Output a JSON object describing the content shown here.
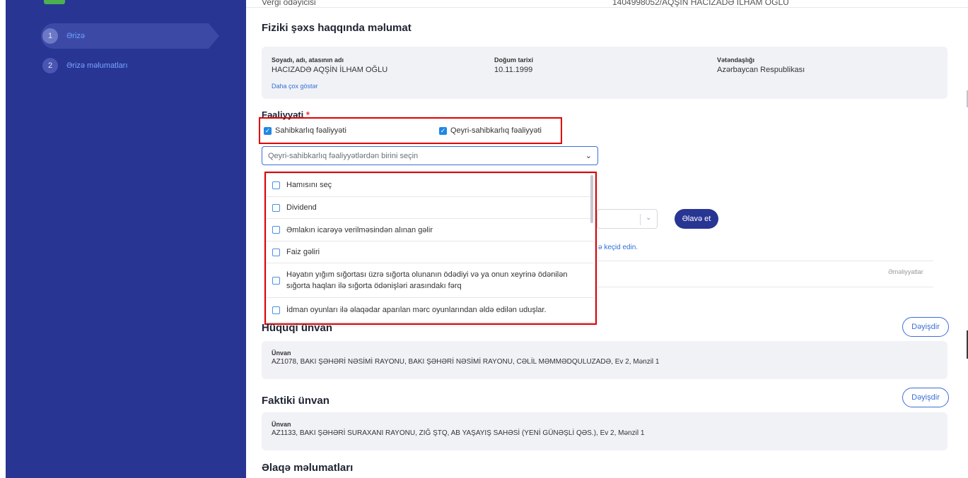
{
  "sidebar": {
    "steps": [
      {
        "number": "1",
        "label": "Ərizə",
        "active": true
      },
      {
        "number": "2",
        "label": "Ərizə məlumatları",
        "active": false
      }
    ]
  },
  "top": {
    "taxpayer_label": "Vergi ödəyicisi",
    "taxpayer_value": "1404998052/AQŞİN HACIZADƏ İLHAM OĞLU"
  },
  "person": {
    "title": "Fiziki şəxs haqqında məlumat",
    "name_label": "Soyadı, adı, atasının adı",
    "name_value": "HACIZADƏ AQŞİN İLHAM OĞLU",
    "birth_label": "Doğum tarixi",
    "birth_value": "10.11.1999",
    "citizenship_label": "Vətəndaşlığı",
    "citizenship_value": "Azərbaycan Respublikası",
    "more_link": "Daha çox göstər"
  },
  "activity": {
    "title": "Fəaliyyəti",
    "required_mark": "*",
    "option1": "Sahibkarlıq fəaliyyəti",
    "option2": "Qeyri-sahibkarlıq fəaliyyəti",
    "select_placeholder": "Qeyri-sahibkarlıq fəaliyyətlərdən birini seçin",
    "dropdown_items": [
      "Hamısını seç",
      "Dividend",
      "Əmlakın icarəyə verilməsindən alınan gəlir",
      "Faiz gəliri",
      "Həyatın yığım sığortası üzrə sığorta olunanın ödədiyi və ya onun xeyrinə ödənilən sığorta haqları ilə sığorta ödənişləri arasındakı fərq",
      "İdman oyunları ilə əlaqədar aparılan mərc oyunlarından əldə edilən uduşlar."
    ],
    "add_button": "Əlavə et",
    "link_tail": "ə keçid edin.",
    "operations_header": "Əməliyyatlar"
  },
  "legal_address": {
    "title": "Hüquqi ünvan",
    "change_button": "Dəyişdir",
    "address_label": "Ünvan",
    "address_value": "AZ1078, BAKI ŞƏHƏRİ NƏSİMİ RAYONU, BAKI ŞƏHƏRİ NƏSİMİ RAYONU, CƏLİL MƏMMƏDQULUZADƏ, Ev 2, Mənzil 1"
  },
  "actual_address": {
    "title": "Faktiki ünvan",
    "change_button": "Dəyişdir",
    "address_label": "Ünvan",
    "address_value": "AZ1133, BAKI ŞƏHƏRİ SURAXANI RAYONU, ZIĞ ŞTQ, AB YAŞAYIŞ SAHƏSİ (YENİ GÜNƏŞLİ QƏS.), Ev 2, Mənzil 1"
  },
  "contact": {
    "title": "Əlaqə məlumatları"
  },
  "colors": {
    "sidebar": "#283593",
    "accent": "#1e88e5",
    "highlight_border": "#e00000"
  }
}
